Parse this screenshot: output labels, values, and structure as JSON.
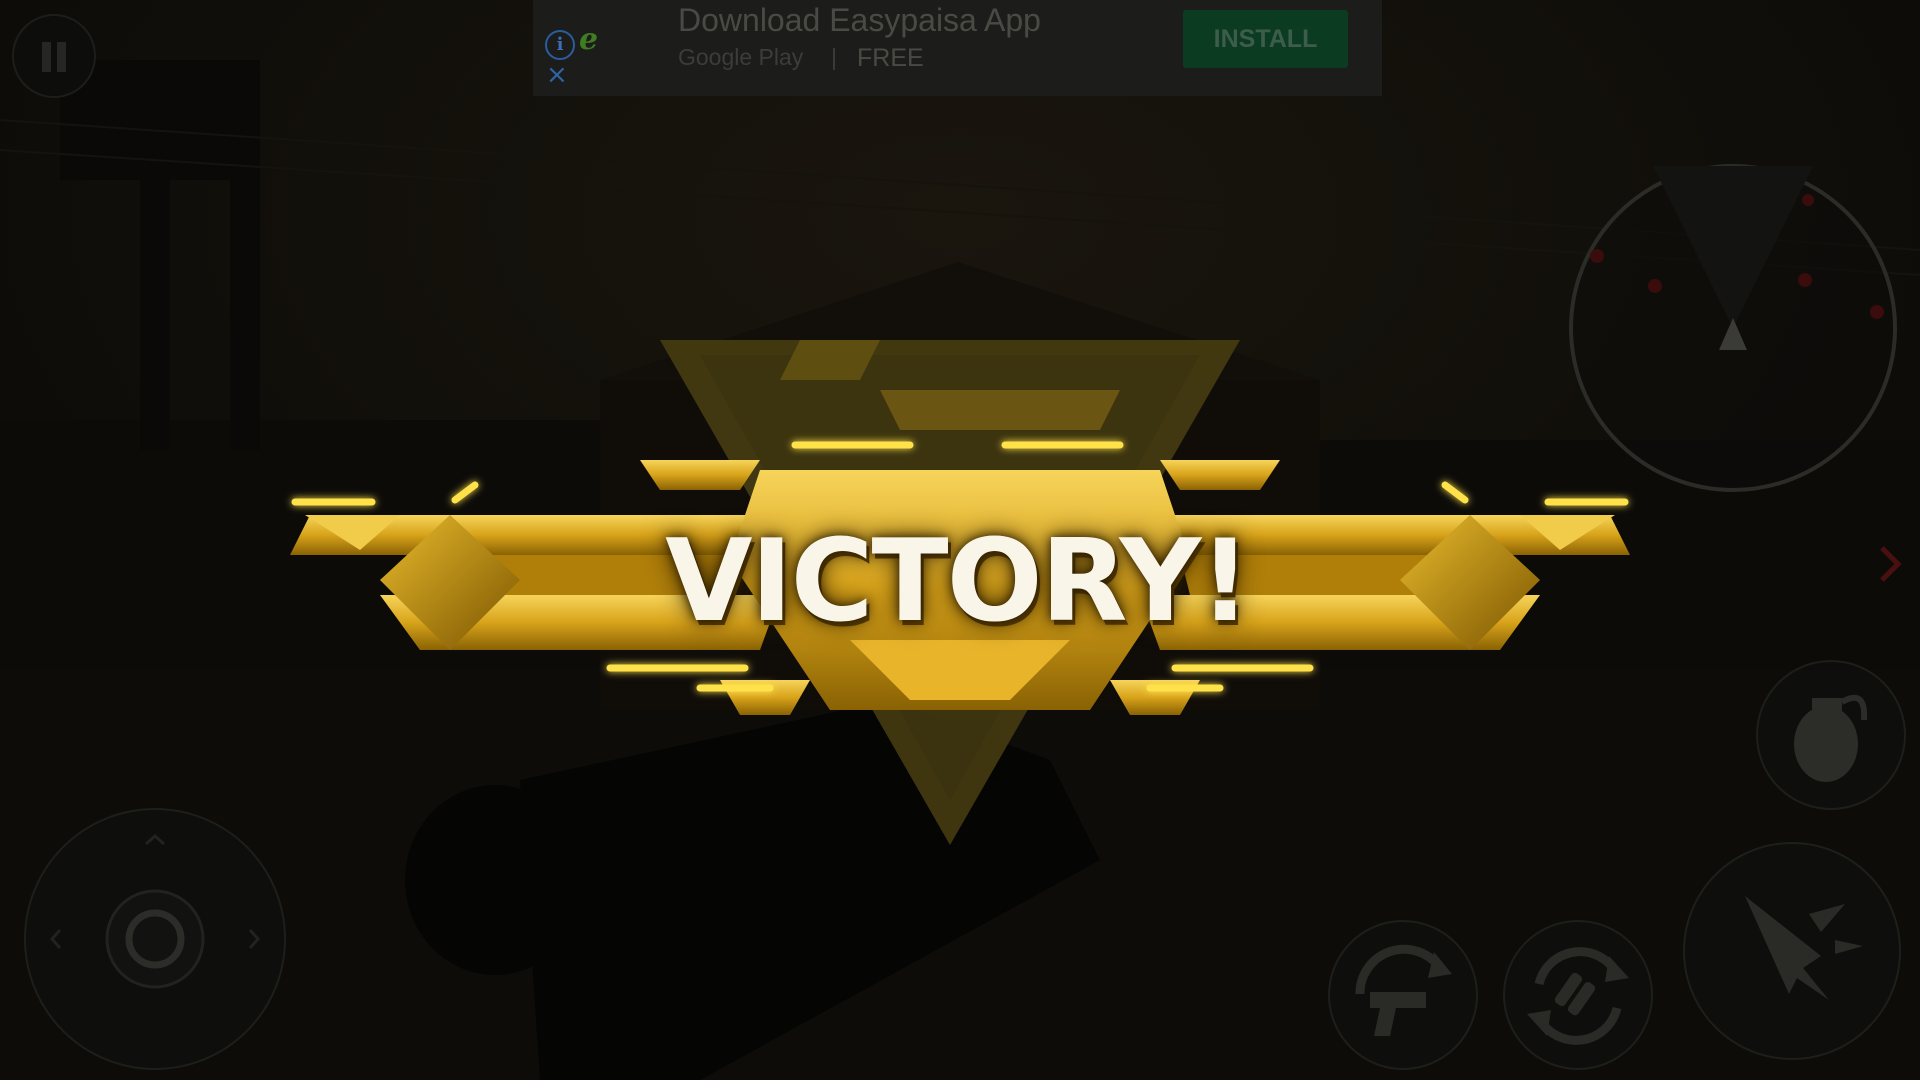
{
  "ad": {
    "title": "Download Easypaisa App",
    "store": "Google Play",
    "separator": "|",
    "price": "FREE",
    "install_label": "INSTALL",
    "info_glyph": "i",
    "close_glyph": "×",
    "logo_glyph": "e",
    "logo_icon": "easypaisa-logo-icon"
  },
  "hud": {
    "pause_icon": "pause-icon",
    "move_icon": "joystick-icon",
    "weapon_switch_icon": "pistol-switch-icon",
    "reload_icon": "ammo-reload-icon",
    "grenade_icon": "grenade-icon",
    "fire_icon": "fire-bullet-icon",
    "radar_icon": "radar-icon",
    "side_arrow_icon": "chevron-right-icon"
  },
  "banner": {
    "title": "VICTORY!",
    "emblem_icon": "victory-emblem-icon",
    "gold_light": "#f3c23a",
    "gold_mid": "#d49a14",
    "gold_dark": "#6a4a00",
    "glow": "#ffe24a"
  },
  "colors": {
    "background": "#0b0a07",
    "ad_background": "#1c1c1a",
    "install_button": "#0b3c22"
  }
}
